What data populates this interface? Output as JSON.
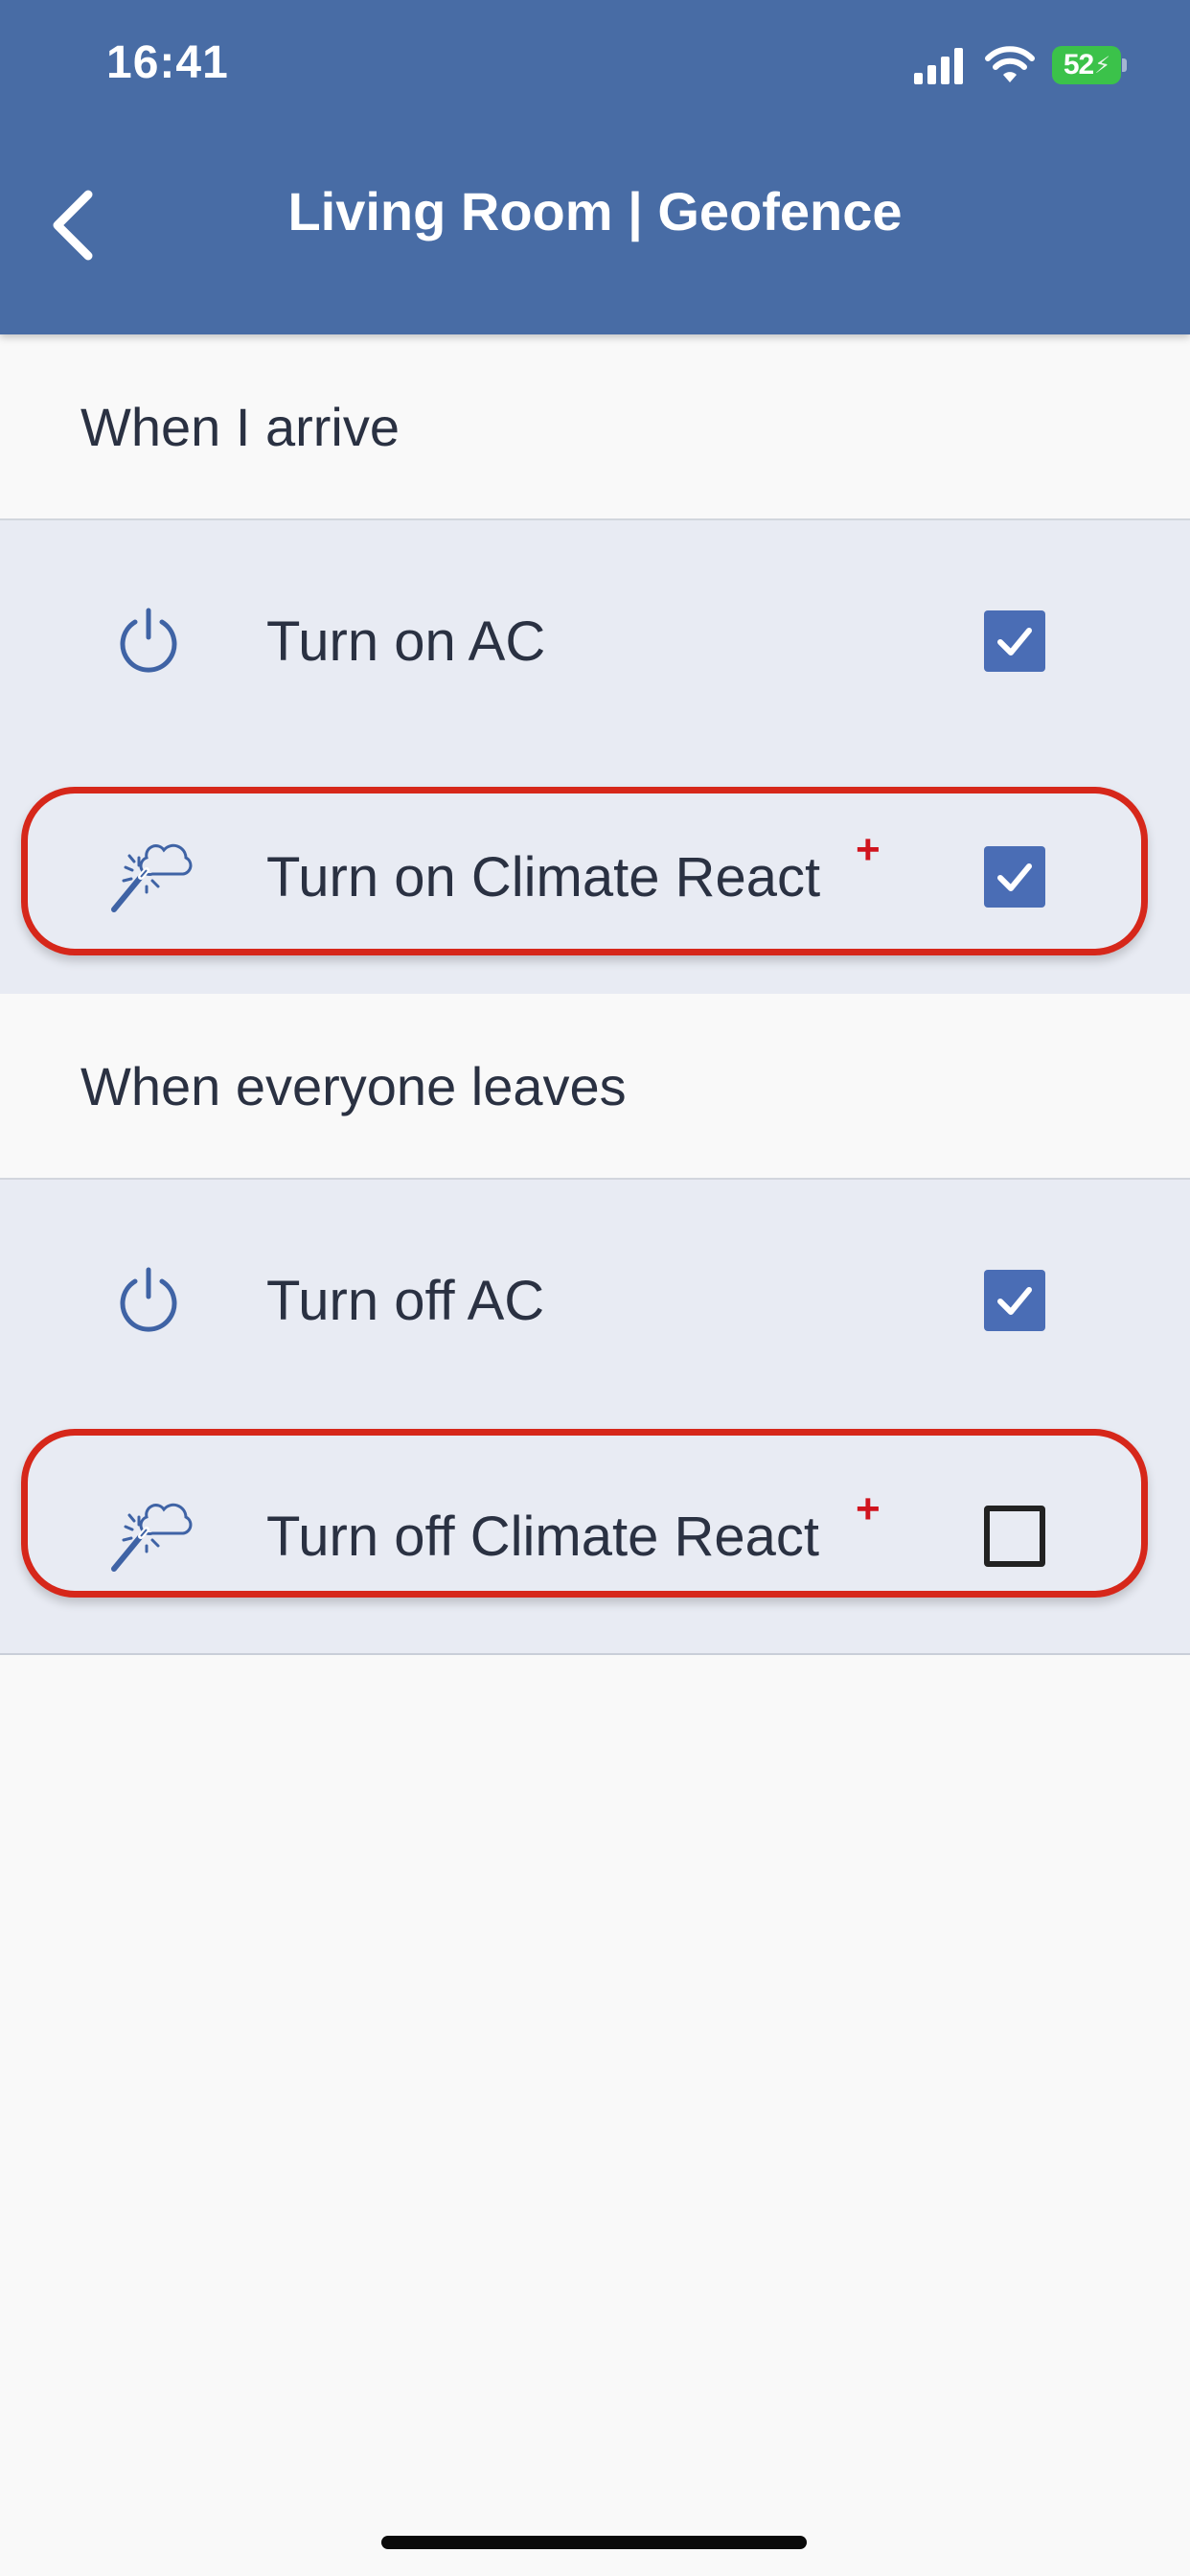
{
  "status_bar": {
    "time": "16:41",
    "battery": "52",
    "signal_icon": "cellular-signal-icon",
    "wifi_icon": "wifi-icon"
  },
  "header": {
    "title": "Living Room | Geofence",
    "back_icon": "chevron-left-icon",
    "background_color": "#486ca5"
  },
  "sections": [
    {
      "label": "When I arrive",
      "options": [
        {
          "icon": "power-icon",
          "label": "Turn on AC",
          "plus": "",
          "checked": true
        },
        {
          "icon": "magic-wand-cloud-icon",
          "label": "Turn on Climate React",
          "plus": "+",
          "checked": true
        }
      ]
    },
    {
      "label": "When everyone leaves",
      "options": [
        {
          "icon": "power-icon",
          "label": "Turn off AC",
          "plus": "",
          "checked": true
        },
        {
          "icon": "magic-wand-cloud-icon",
          "label": "Turn off Climate React",
          "plus": "+",
          "checked": false
        }
      ]
    }
  ],
  "colors": {
    "accent": "#4a6db5",
    "highlight": "#d6271a",
    "plus_badge": "#d0141e",
    "options_background": "#e8ebf3"
  }
}
